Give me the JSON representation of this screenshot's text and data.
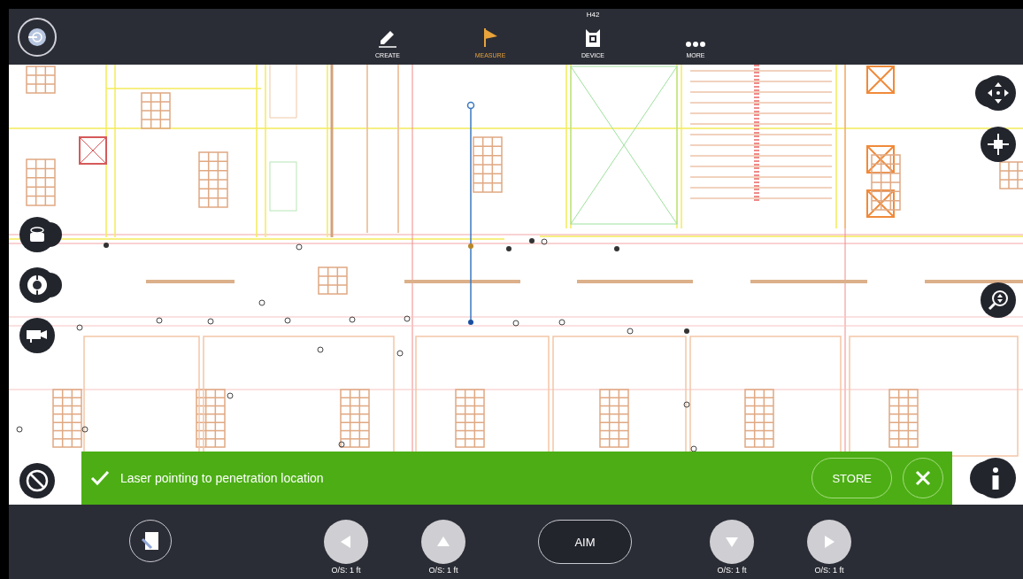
{
  "top_bar": {
    "tabs": [
      {
        "label": "CREATE",
        "selected": false,
        "kind": "pencil"
      },
      {
        "label": "MEASURE",
        "selected": true,
        "kind": "flag"
      },
      {
        "label": "DEVICE",
        "selected": false,
        "kind": "device",
        "badge": "H42"
      },
      {
        "label": "MORE",
        "selected": false,
        "kind": "dots"
      }
    ]
  },
  "status_banner": {
    "message": "Laser pointing to penetration location",
    "action": "STORE"
  },
  "bottom_bar": {
    "aim_button": "AIM",
    "offset_buttons": [
      {
        "kind": "left",
        "offset": "O/S: 1 ft"
      },
      {
        "kind": "up",
        "offset": "O/S: 1 ft"
      }
    ],
    "offset_buttons_right": [
      {
        "kind": "down",
        "offset": "O/S: 1 ft"
      },
      {
        "kind": "right",
        "offset": "O/S: 1 ft"
      }
    ]
  }
}
